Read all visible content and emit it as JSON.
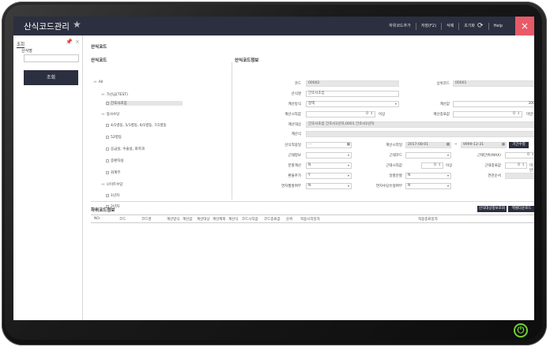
{
  "app": {
    "title": "산식코드관리"
  },
  "header_links": {
    "add_subcode": "하위코드추가",
    "save": "저장(F2)",
    "delete": "삭제",
    "reset": "초기화",
    "help": "Help",
    "close": "×"
  },
  "search_panel": {
    "title": "조회",
    "field_label": "산식명",
    "field_value": "",
    "search_button": "조회"
  },
  "main": {
    "section_title": "산식코드",
    "tree_title": "산식코드",
    "form_title": "산식코드정보"
  },
  "tree": {
    "items": [
      {
        "label": "All",
        "icon": "folder-icon"
      },
      {
        "label": "가산금(TEST)",
        "icon": "folder-icon"
      },
      {
        "label": "간호사초임",
        "icon": "file-icon"
      },
      {
        "label": "봉사수당",
        "icon": "folder-icon"
      },
      {
        "label": "4/1병동, 5/1병동, 6/1병동, 7/1병동",
        "icon": "file-icon"
      },
      {
        "label": "52병동",
        "icon": "file-icon"
      },
      {
        "label": "응급실, 수술실, 화학과",
        "icon": "file-icon"
      },
      {
        "label": "중환자실",
        "icon": "file-icon"
      },
      {
        "label": "회계부",
        "icon": "file-icon"
      },
      {
        "label": "나이트수당",
        "icon": "folder-icon"
      },
      {
        "label": "1년차",
        "icon": "file-icon"
      },
      {
        "label": "2년차",
        "icon": "file-icon"
      }
    ]
  },
  "form": {
    "code_label": "코드",
    "code_value": "00002",
    "parent_code_label": "상위코드",
    "parent_code_value": "00001",
    "name_label": "산식명",
    "name_value": "간호사초임",
    "calc_method_label": "계산방식",
    "calc_method_value": "정액",
    "calc_value_label": "계산값",
    "calc_value": "300,000",
    "calc_start_label": "계산시작값",
    "calc_start_value": "0",
    "calc_start_suffix": "이상",
    "calc_end_label": "계산종료값",
    "calc_end_value": "0",
    "calc_end_suffix": "미만",
    "calc_target_label": "계산대상",
    "calc_target_value": "간호사초임 간호사1년차,0001 간호사1년차",
    "calc_expr_label": "계산식",
    "apply_date_label": "산식적용일",
    "apply_date_value": "- -",
    "calc_start_date_label": "계산시작일",
    "calc_start_date_value": "2017-08-01",
    "calc_end_date_label": "계산종료일",
    "calc_end_date_value": "9999-12-31",
    "period_button": "기간수정",
    "diligence_label": "근태정보",
    "diligence_value": "",
    "diligence_code_label": "근태코드",
    "diligence_code_value": "",
    "diligence_unit_label": "근태단위(MAX)",
    "diligence_unit_value": "0",
    "prorate_label": "분할계산",
    "prorate_value": "N",
    "diligence_start_label": "근태시작값",
    "diligence_start_value": "0",
    "diligence_start_suffix": "이상",
    "diligence_end_label": "근태종료값",
    "diligence_end_value": "0",
    "diligence_end_suffix": "미만",
    "overtime_label": "환율추가",
    "overtime_value": "Y",
    "daily_label": "일할분할",
    "daily_value": "N",
    "round_label": "연관순서",
    "round_value": "",
    "yearly_label": "연차월할여부",
    "yearly_value": "N",
    "yearly_round_label": "연차수당유형여부",
    "yearly_round_value": "N"
  },
  "sub_grid": {
    "title": "하위코드정보",
    "btn_target": "산식대상정보조회",
    "btn_excel": "엑셀다운로드",
    "columns": [
      "NO.",
      "코드",
      "코드명",
      "계산방식",
      "계산값",
      "계산대상",
      "계산제외",
      "계산식",
      "코드시작값",
      "코드종료값",
      "순위",
      "적용시작일자",
      "적용종료일자"
    ]
  }
}
